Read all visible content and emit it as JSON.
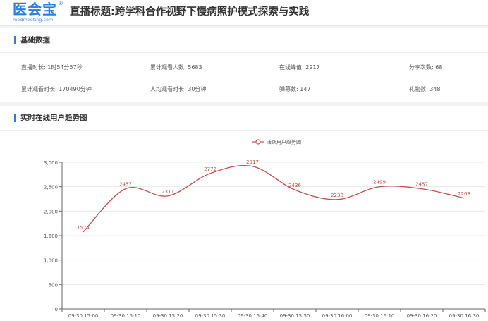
{
  "header": {
    "logo_text": "医会宝",
    "logo_reg": "®",
    "logo_subtext": "medmeeting.com",
    "page_title": "直播标题:跨学科合作视野下慢病照护模式探索与实践"
  },
  "basic": {
    "section_title": "基础数据",
    "stats": [
      {
        "label": "直播时长: ",
        "value": "1时54分57秒"
      },
      {
        "label": "累计观看人数: ",
        "value": "5683"
      },
      {
        "label": "在线峰值: ",
        "value": "2917"
      },
      {
        "label": "分享次数: ",
        "value": "68"
      },
      {
        "label": "累计观看时长: ",
        "value": "170490分钟"
      },
      {
        "label": "人均观看时长: ",
        "value": "30分钟"
      },
      {
        "label": "弹幕数: ",
        "value": "147"
      },
      {
        "label": "礼物数: ",
        "value": "348"
      }
    ]
  },
  "trend": {
    "section_title": "实时在线用户趋势图"
  },
  "colors": {
    "accent": "#2b7fd8",
    "series": "#c0504d",
    "axis": "#666666",
    "grid": "#e8e8e8"
  },
  "chart_data": {
    "type": "line",
    "title": "",
    "xlabel": "",
    "ylabel": "",
    "legend_position": "top-center",
    "grid": true,
    "smooth": true,
    "x": [
      "09-30 15:00",
      "09-30 15:10",
      "09-30 15:20",
      "09-30 15:30",
      "09-30 15:40",
      "09-30 15:50",
      "09-30 16:00",
      "09-30 16:10",
      "09-30 16:20",
      "09-30 16:30"
    ],
    "ylim": [
      0,
      3000
    ],
    "yticks": [
      0,
      500,
      1000,
      1500,
      2000,
      2500,
      3000
    ],
    "ytick_labels": [
      "0",
      "500",
      "1,000",
      "1,500",
      "2,000",
      "2,500",
      "3,000"
    ],
    "series": [
      {
        "name": "活跃用户趋势图",
        "values": [
          1574,
          2457,
          2311,
          2772,
          2917,
          2436,
          2238,
          2499,
          2457,
          2268
        ]
      }
    ]
  }
}
